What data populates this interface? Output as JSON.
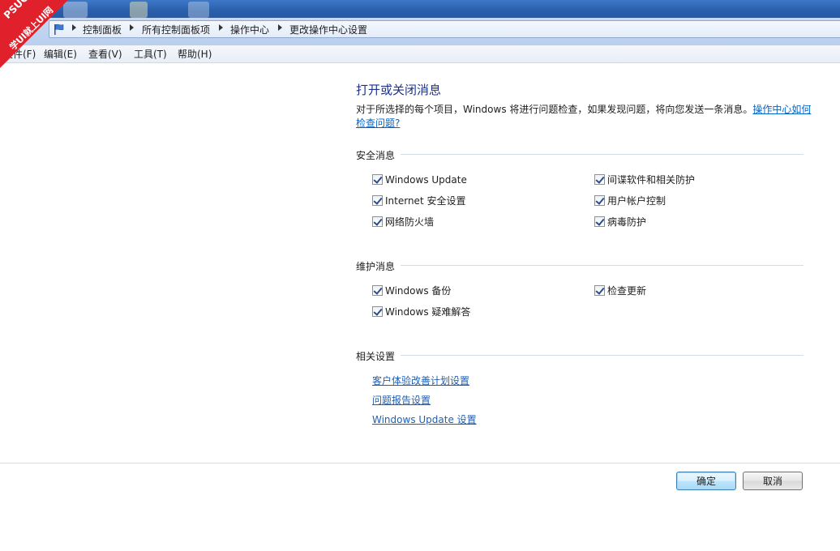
{
  "breadcrumb": {
    "items": [
      "控制面板",
      "所有控制面板项",
      "操作中心",
      "更改操作中心设置"
    ]
  },
  "menu": {
    "items": [
      "文件(F)",
      "编辑(E)",
      "查看(V)",
      "工具(T)",
      "帮助(H)"
    ]
  },
  "watermark": {
    "line1": "PSUG",
    "line2": "学UI就上UI网"
  },
  "main": {
    "title": "打开或关闭消息",
    "description": "对于所选择的每个项目，Windows 将进行问题检查，如果发现问题，将向您发送一条消息。",
    "help_link": "操作中心如何检查问题?",
    "security": {
      "title": "安全消息",
      "items": [
        {
          "label": "Windows Update",
          "checked": true
        },
        {
          "label": "间谍软件和相关防护",
          "checked": true
        },
        {
          "label": "Internet 安全设置",
          "checked": true
        },
        {
          "label": "用户帐户控制",
          "checked": true
        },
        {
          "label": "网络防火墙",
          "checked": true
        },
        {
          "label": "病毒防护",
          "checked": true
        }
      ]
    },
    "maintenance": {
      "title": "维护消息",
      "items": [
        {
          "label": "Windows 备份",
          "checked": true
        },
        {
          "label": "检查更新",
          "checked": true
        },
        {
          "label": "Windows 疑难解答",
          "checked": true
        }
      ]
    },
    "related": {
      "title": "相关设置",
      "links": [
        "客户体验改善计划设置",
        "问题报告设置",
        "Windows Update 设置"
      ]
    }
  },
  "footer": {
    "ok_label": "确定",
    "cancel_label": "取消"
  },
  "colors": {
    "title": "#1e3287",
    "link": "#0066cc",
    "accent": "#2a5fa9"
  }
}
